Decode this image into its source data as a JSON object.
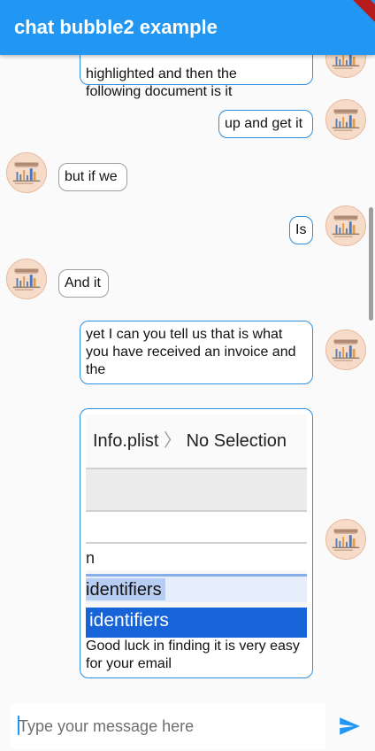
{
  "app": {
    "title": "chat bubble2 example"
  },
  "messages": [
    {
      "from": "me",
      "text": "highlighted and then the\nfollowing document is it"
    },
    {
      "from": "me",
      "text": "up and get it"
    },
    {
      "from": "other",
      "text": "but if we"
    },
    {
      "from": "me",
      "text": "Is"
    },
    {
      "from": "other",
      "text": "And it"
    },
    {
      "from": "me",
      "text": "yet I can you tell us that is what you have received an invoice and the"
    },
    {
      "from": "me",
      "image": {
        "header_file": "Info.plist",
        "header_chevron": "〉",
        "header_status": "No Selection",
        "row_partial": "n",
        "row_selected_light": "identifiers",
        "row_selected_dark": "identifiers"
      },
      "text": "Good luck in finding it is very easy for your email"
    }
  ],
  "composer": {
    "placeholder": "Type your message here",
    "send_icon": "send-icon"
  },
  "colors": {
    "primary": "#2196f3",
    "bubble_out_border": "#2e8fe0",
    "bubble_in_border": "#9e9e9e"
  }
}
